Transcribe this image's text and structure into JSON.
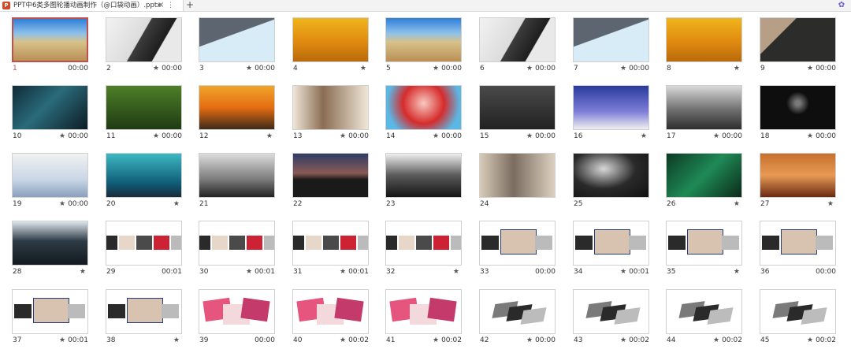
{
  "tab": {
    "title": "PPT中6类多图轮播动画制作（@口袋动画）.pptx",
    "icon": "P",
    "close": "×",
    "more": "⋮",
    "add": "+",
    "ext_icon": "✿"
  },
  "slides": [
    {
      "n": "1",
      "star": "",
      "time": "00:00",
      "art": "beach"
    },
    {
      "n": "2",
      "star": "★",
      "time": "00:00",
      "art": "laptop"
    },
    {
      "n": "3",
      "star": "★",
      "time": "00:00",
      "art": "bridge"
    },
    {
      "n": "4",
      "star": "★",
      "time": "",
      "art": "autumn"
    },
    {
      "n": "5",
      "star": "★",
      "time": "00:00",
      "art": "beach"
    },
    {
      "n": "6",
      "star": "★",
      "time": "00:00",
      "art": "laptop"
    },
    {
      "n": "7",
      "star": "★",
      "time": "00:00",
      "art": "bridge"
    },
    {
      "n": "8",
      "star": "★",
      "time": "",
      "art": "autumn"
    },
    {
      "n": "9",
      "star": "★",
      "time": "00:00",
      "art": "dark1"
    },
    {
      "n": "10",
      "star": "★",
      "time": "00:00",
      "art": "cave"
    },
    {
      "n": "11",
      "star": "★",
      "time": "00:00",
      "art": "toucan"
    },
    {
      "n": "12",
      "star": "★",
      "time": "",
      "art": "sunset"
    },
    {
      "n": "13",
      "star": "★",
      "time": "00:00",
      "art": "store"
    },
    {
      "n": "14",
      "star": "★",
      "time": "00:00",
      "art": "red"
    },
    {
      "n": "15",
      "star": "★",
      "time": "00:00",
      "art": "wings"
    },
    {
      "n": "16",
      "star": "★",
      "time": "",
      "art": "stage"
    },
    {
      "n": "17",
      "star": "★",
      "time": "00:00",
      "art": "station"
    },
    {
      "n": "18",
      "star": "★",
      "time": "00:00",
      "art": "black"
    },
    {
      "n": "19",
      "star": "★",
      "time": "00:00",
      "art": "desk"
    },
    {
      "n": "20",
      "star": "★",
      "time": "",
      "art": "teal"
    },
    {
      "n": "21",
      "star": "",
      "time": "",
      "art": "bus"
    },
    {
      "n": "22",
      "star": "",
      "time": "",
      "art": "dusk"
    },
    {
      "n": "23",
      "star": "",
      "time": "",
      "art": "bw"
    },
    {
      "n": "24",
      "star": "",
      "time": "",
      "art": "street"
    },
    {
      "n": "25",
      "star": "",
      "time": "",
      "art": "bwcave"
    },
    {
      "n": "26",
      "star": "★",
      "time": "",
      "art": "green"
    },
    {
      "n": "27",
      "star": "★",
      "time": "",
      "art": "canyon"
    },
    {
      "n": "28",
      "star": "★",
      "time": "",
      "art": "forest"
    },
    {
      "n": "29",
      "star": "",
      "time": "00:01",
      "art": "strip"
    },
    {
      "n": "30",
      "star": "★",
      "time": "00:01",
      "art": "strip"
    },
    {
      "n": "31",
      "star": "★",
      "time": "00:01",
      "art": "strip"
    },
    {
      "n": "32",
      "star": "★",
      "time": "",
      "art": "strip"
    },
    {
      "n": "33",
      "star": "",
      "time": "00:00",
      "art": "strip2"
    },
    {
      "n": "34",
      "star": "★",
      "time": "00:01",
      "art": "strip2"
    },
    {
      "n": "35",
      "star": "★",
      "time": "",
      "art": "strip2"
    },
    {
      "n": "36",
      "star": "",
      "time": "00:00",
      "art": "strip2"
    },
    {
      "n": "37",
      "star": "★",
      "time": "00:01",
      "art": "strip2"
    },
    {
      "n": "38",
      "star": "★",
      "time": "",
      "art": "strip2"
    },
    {
      "n": "39",
      "star": "",
      "time": "00:00",
      "art": "pinkstack"
    },
    {
      "n": "40",
      "star": "★",
      "time": "00:02",
      "art": "pinkstack"
    },
    {
      "n": "41",
      "star": "★",
      "time": "00:02",
      "art": "pinkstack"
    },
    {
      "n": "42",
      "star": "★",
      "time": "00:00",
      "art": "tilt"
    },
    {
      "n": "43",
      "star": "★",
      "time": "00:02",
      "art": "tilt"
    },
    {
      "n": "44",
      "star": "★",
      "time": "00:02",
      "art": "tilt"
    },
    {
      "n": "45",
      "star": "★",
      "time": "00:02",
      "art": "tilt"
    }
  ],
  "selected": "1",
  "colors": {
    "accent": "#c0504d"
  }
}
